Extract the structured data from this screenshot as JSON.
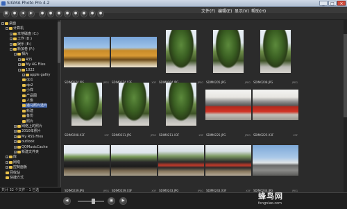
{
  "app": {
    "title": "SIGMA Photo Pro 4.2",
    "window_buttons": [
      "_",
      "□",
      "×"
    ],
    "menu": [
      "文件(F)",
      "编辑(E)",
      "显示(V)",
      "帮助(H)"
    ]
  },
  "toolbar": {
    "buttons": [
      {
        "icon": "folder-icon",
        "glyph": "▣"
      },
      {
        "icon": "circle-icon",
        "glyph": "●"
      },
      {
        "icon": "back-icon",
        "glyph": "◀"
      },
      {
        "icon": "forward-icon",
        "glyph": "▶"
      },
      {
        "icon": "tool-icon",
        "glyph": "●"
      },
      {
        "icon": "tool-icon",
        "glyph": "●"
      },
      {
        "icon": "tool-icon",
        "glyph": "●"
      },
      {
        "icon": "tool-icon",
        "glyph": "●"
      },
      {
        "icon": "tool-icon",
        "glyph": "●"
      },
      {
        "icon": "tool-icon",
        "glyph": "●"
      },
      {
        "icon": "tool-icon",
        "glyph": "●"
      },
      {
        "icon": "tool-icon",
        "glyph": "●"
      }
    ]
  },
  "sidebar": {
    "tree": [
      {
        "label": "桌面",
        "level": 0,
        "expand": "-",
        "selected": false
      },
      {
        "label": "计算机",
        "level": 1,
        "expand": "-",
        "selected": false
      },
      {
        "label": "本地磁盘 (C:)",
        "level": 2,
        "expand": "+",
        "selected": false
      },
      {
        "label": "工作 (D:)",
        "level": 2,
        "expand": "+",
        "selected": false
      },
      {
        "label": "娱乐 (E:)",
        "level": 2,
        "expand": "+",
        "selected": false
      },
      {
        "label": "新加卷 (F:)",
        "level": 2,
        "expand": "-",
        "selected": false
      },
      {
        "label": "相片",
        "level": 3,
        "expand": "-",
        "selected": false
      },
      {
        "label": "435",
        "level": 4,
        "expand": "+",
        "selected": false
      },
      {
        "label": "My 4G Files",
        "level": 4,
        "expand": "+",
        "selected": false
      },
      {
        "label": "1022",
        "level": 4,
        "expand": "-",
        "selected": false
      },
      {
        "label": "apple gallry",
        "level": 5,
        "expand": "+",
        "selected": false
      },
      {
        "label": "dp1",
        "level": 5,
        "expand": "",
        "selected": false
      },
      {
        "label": "dp2",
        "level": 5,
        "expand": "",
        "selected": false
      },
      {
        "label": "小样",
        "level": 5,
        "expand": "",
        "selected": false
      },
      {
        "label": "产品图",
        "level": 5,
        "expand": "",
        "selected": false
      },
      {
        "label": "人像",
        "level": 5,
        "expand": "",
        "selected": false
      },
      {
        "label": "适马照片选片",
        "level": 5,
        "expand": "",
        "selected": true
      },
      {
        "label": "新建",
        "level": 5,
        "expand": "",
        "selected": false
      },
      {
        "label": "备份",
        "level": 5,
        "expand": "",
        "selected": false
      },
      {
        "label": "照片",
        "level": 5,
        "expand": "",
        "selected": false
      },
      {
        "label": "网络上的照片",
        "level": 3,
        "expand": "+",
        "selected": false
      },
      {
        "label": "2010年照片",
        "level": 3,
        "expand": "+",
        "selected": false
      },
      {
        "label": "My RSS Files",
        "level": 3,
        "expand": "+",
        "selected": false
      },
      {
        "label": "outlook",
        "level": 3,
        "expand": "+",
        "selected": false
      },
      {
        "label": "QQMusicCache",
        "level": 3,
        "expand": "+",
        "selected": false
      },
      {
        "label": "新建文件夹",
        "level": 3,
        "expand": "+",
        "selected": false
      },
      {
        "label": "库",
        "level": 1,
        "expand": "+",
        "selected": false
      },
      {
        "label": "网络",
        "level": 1,
        "expand": "+",
        "selected": false
      },
      {
        "label": "控制面板",
        "level": 1,
        "expand": "+",
        "selected": false
      },
      {
        "label": "回收站",
        "level": 1,
        "expand": "",
        "selected": false
      },
      {
        "label": "快捷方式",
        "level": 1,
        "expand": "",
        "selected": false
      }
    ],
    "status": "共计 32 个文件 - 1 已选"
  },
  "thumbnails": [
    {
      "name": "SDIM0174.JPG",
      "meta": "JPEG",
      "img": "img-autumn",
      "selected": false
    },
    {
      "name": "SDIM0174.X3F",
      "meta": "X3F",
      "img": "img-autumn",
      "selected": false
    },
    {
      "name": "SDIM0204.JPG",
      "meta": "JPEG",
      "img": "img-park",
      "selected": false
    },
    {
      "name": "SDIM0205.JPG",
      "meta": "JPEG",
      "img": "img-park",
      "selected": false
    },
    {
      "name": "SDIM0208.JPG",
      "meta": "JPEG",
      "img": "img-park",
      "selected": false
    },
    {
      "name": "SDIM0208.X3F",
      "meta": "X3F",
      "img": "img-park",
      "selected": false
    },
    {
      "name": "SDIM0211.JPG",
      "meta": "JPEG",
      "img": "img-park",
      "selected": false
    },
    {
      "name": "SDIM0211.X3F",
      "meta": "X3F",
      "img": "img-park",
      "selected": false
    },
    {
      "name": "SDIM0225.JPG",
      "meta": "JPEG",
      "img": "img-gate",
      "selected": false
    },
    {
      "name": "SDIM0225.X3F",
      "meta": "X3F",
      "img": "img-gate",
      "selected": false
    },
    {
      "name": "SDIM0239.JPG",
      "meta": "JPEG",
      "img": "img-train",
      "selected": false
    },
    {
      "name": "SDIM0239.X3F",
      "meta": "X3F",
      "img": "img-train",
      "selected": false
    },
    {
      "name": "SDIM0243.JPG",
      "meta": "JPEG",
      "img": "img-traintop",
      "selected": false
    },
    {
      "name": "SDIM0243.X3F",
      "meta": "X3F",
      "img": "img-traintop",
      "selected": false
    },
    {
      "name": "SDIM0244.JPG",
      "meta": "JPEG",
      "img": "img-road",
      "selected": false
    }
  ],
  "bottom": {
    "prev_glyph": "◀",
    "next_glyph": "▶",
    "zoom_glyph": "▣"
  },
  "watermark": {
    "brand": "蜂鸟网",
    "url": "fengniao.com"
  }
}
